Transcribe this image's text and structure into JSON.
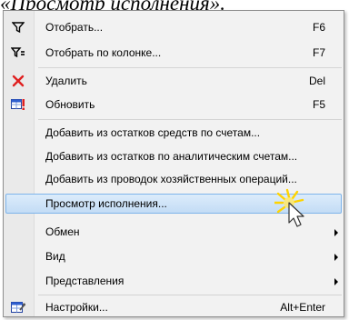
{
  "caption": "«Просмотр исполнения».",
  "menu": {
    "items": [
      {
        "label": "Отобрать...",
        "shortcut": "F6",
        "icon": "filter-icon"
      },
      {
        "label": "Отобрать по колонке...",
        "shortcut": "F7",
        "icon": "filter-by-column-icon"
      },
      {
        "label": "Удалить",
        "shortcut": "Del",
        "icon": "delete-x-icon"
      },
      {
        "label": "Обновить",
        "shortcut": "F5",
        "icon": "refresh-table-icon"
      },
      {
        "label": "Добавить из остатков средств по счетам..."
      },
      {
        "label": "Добавить из остатков по аналитическим счетам..."
      },
      {
        "label": "Добавить из проводок хозяйственных операций..."
      },
      {
        "label": "Просмотр исполнения..."
      },
      {
        "label": "Обмен"
      },
      {
        "label": "Вид"
      },
      {
        "label": "Представления"
      },
      {
        "label": "Настройки...",
        "shortcut": "Alt+Enter",
        "icon": "settings-table-icon"
      }
    ]
  },
  "colors": {
    "highlight_border": "#7eb4ea",
    "delete_icon": "#e02020",
    "click_burst": "#ffd400"
  }
}
